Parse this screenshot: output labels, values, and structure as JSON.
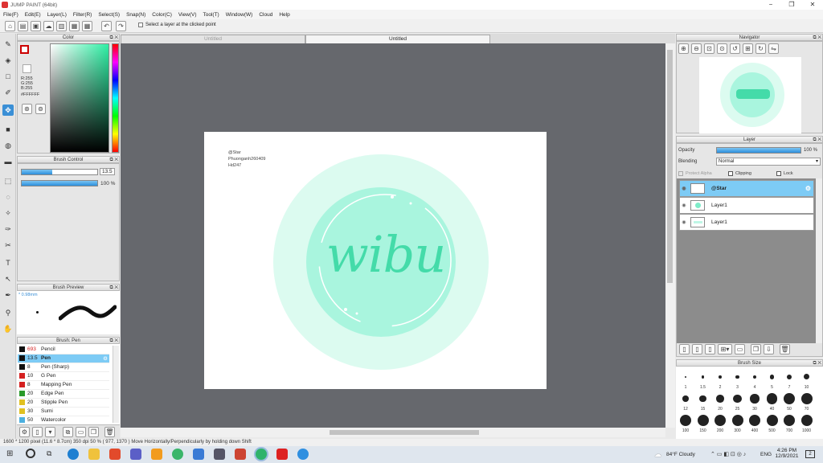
{
  "window": {
    "title": "JUMP PAINT (64bit)",
    "minimize": "−",
    "maximize": "❐",
    "close": "✕"
  },
  "menu": [
    "File(F)",
    "Edit(E)",
    "Layer(L)",
    "Filter(R)",
    "Select(S)",
    "Snap(N)",
    "Color(C)",
    "View(V)",
    "Tool(T)",
    "Window(W)",
    "Cloud",
    "Help"
  ],
  "toolbar": {
    "hint": "Select a layer at the clicked point"
  },
  "color_panel": {
    "title": "Color",
    "r": "R:255",
    "g": "G:255",
    "b": "B:255",
    "hex": "#FFFFFF",
    "accent": "#2ff0a5"
  },
  "brush_control": {
    "title": "Brush Control",
    "size": "13.5",
    "opacity": "100 %",
    "size_fill": 0.4,
    "opacity_fill": 1.0
  },
  "brush_preview": {
    "title": "Brush Preview",
    "size_label": "* 0.98mm"
  },
  "brush_list": {
    "title": "Brush: Pen",
    "items": [
      {
        "size": "693",
        "name": "Pencil",
        "color": "#111"
      },
      {
        "size": "13.5",
        "name": "Pen",
        "color": "#111",
        "selected": true
      },
      {
        "size": "8",
        "name": "Pen (Sharp)",
        "color": "#111"
      },
      {
        "size": "10",
        "name": "G Pen",
        "color": "#d42020"
      },
      {
        "size": "8",
        "name": "Mapping Pen",
        "color": "#d42020"
      },
      {
        "size": "20",
        "name": "Edge Pen",
        "color": "#2a9a2a"
      },
      {
        "size": "20",
        "name": "Stipple Pen",
        "color": "#e0c020"
      },
      {
        "size": "30",
        "name": "Sumi",
        "color": "#e0c020"
      },
      {
        "size": "50",
        "name": "Watercolor",
        "color": "#4cb0e0"
      }
    ]
  },
  "tabs": [
    "Untitled",
    "Untitled"
  ],
  "document": {
    "lines": [
      "@Star",
      "Phuonganh260409",
      "Hd247"
    ],
    "logo_text": "wibu"
  },
  "navigator": {
    "title": "Navigator"
  },
  "layer_panel": {
    "title": "Layer",
    "opacity_label": "Opacity",
    "opacity_value": "100 %",
    "blending_label": "Blending",
    "blending_value": "Normal",
    "protect_alpha": "Protect Alpha",
    "clipping": "Clipping",
    "lock": "Lock",
    "layers": [
      {
        "name": "@Star",
        "selected": true
      },
      {
        "name": "Layer1"
      },
      {
        "name": "Layer1"
      }
    ]
  },
  "brush_size": {
    "title": "Brush Size",
    "labels": [
      "1",
      "1.5",
      "2",
      "3",
      "4",
      "5",
      "7",
      "10",
      "12",
      "15",
      "20",
      "25",
      "30",
      "40",
      "50",
      "70",
      "100",
      "150",
      "200",
      "300",
      "400",
      "500",
      "700",
      "1000"
    ]
  },
  "status": {
    "text": "1600 * 1200 pixel  (11.6 * 8.7cm)  350 dpi  50 %  ( 977, 1370 )  Move Horizontally/Perpendicularly by holding down Shift"
  },
  "taskbar": {
    "weather": "84°F  Cloudy",
    "lang": "ENG",
    "time": "4:26 PM",
    "date": "12/9/2021",
    "notif": "2"
  }
}
